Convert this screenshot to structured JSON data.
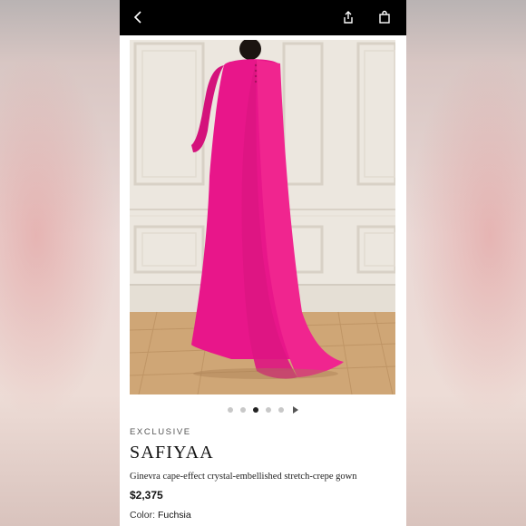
{
  "topbar": {
    "back_icon": "chevron-left-icon",
    "share_icon": "share-icon",
    "bag_icon": "shopping-bag-icon"
  },
  "gallery": {
    "total_images": 5,
    "active_index": 3
  },
  "product": {
    "label": "EXCLUSIVE",
    "brand": "SAFIYAA",
    "name": "Ginevra cape-effect crystal-embellished stretch-crepe gown",
    "price": "$2,375",
    "color_label": "Color:",
    "color_value": "Fuchsia"
  },
  "colors": {
    "dress": "#ec1a8c",
    "topbar": "#000000"
  }
}
